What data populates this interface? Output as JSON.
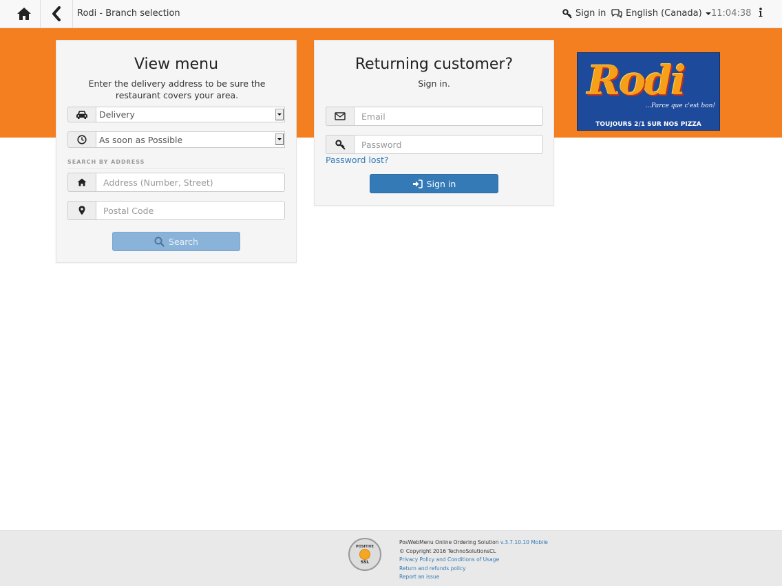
{
  "topbar": {
    "title": "Rodi - Branch selection",
    "sign_in": "Sign in",
    "language": "English (Canada)",
    "time": "11:04:38"
  },
  "left_panel": {
    "title": "View menu",
    "subtitle": "Enter the delivery address to be sure the restaurant covers your area.",
    "mode_value": "Delivery",
    "time_value": "As soon as Possible",
    "section_label": "SEARCH BY ADDRESS",
    "address_placeholder": "Address (Number, Street)",
    "postal_placeholder": "Postal Code",
    "search_label": "Search"
  },
  "right_panel": {
    "title": "Returning customer?",
    "subtitle": "Sign in.",
    "email_placeholder": "Email",
    "password_placeholder": "Password",
    "password_lost": "Password lost?",
    "sign_in_label": "Sign in"
  },
  "logo": {
    "word": "Rodi",
    "tagline": "...Parce que c'est bon!",
    "bottom": "TOUJOURS 2/1 SUR NOS PIZZA"
  },
  "footer": {
    "product": "PosWebMenu Online Ordering Solution",
    "version": "v.3.7.10.10 Mobile",
    "copyright": "© Copyright 2016 TechnoSolutionsCL",
    "privacy": "Privacy Policy and Conditions of Usage",
    "refunds": "Return and refunds policy",
    "report": "Report an issue",
    "badge_top": "POSITIVE",
    "badge_bottom": "SSL"
  },
  "colors": {
    "accent_orange": "#f47f20",
    "primary_blue": "#337ab7",
    "logo_blue": "#1d4a9a"
  }
}
